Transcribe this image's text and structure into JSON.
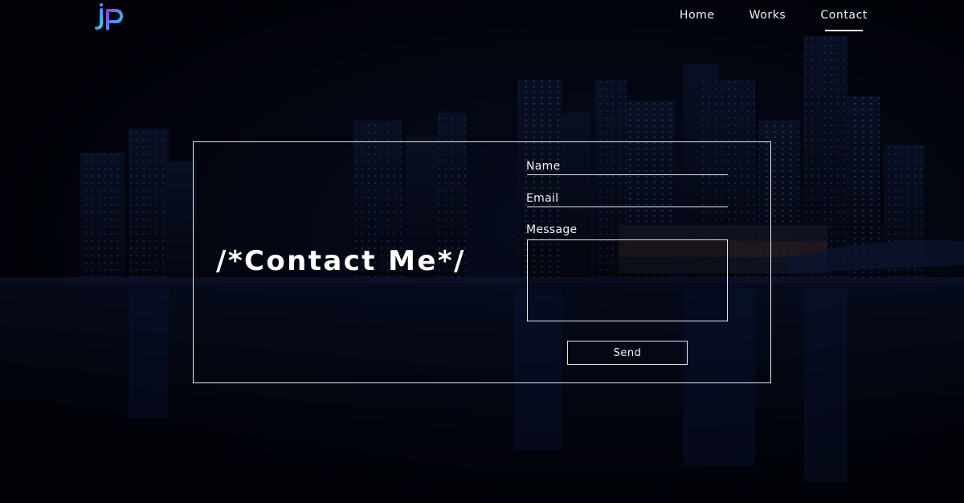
{
  "logo": {
    "icon": "jp-monogram-logo",
    "gradient": [
      "#7b3fe4",
      "#2fd6f2"
    ]
  },
  "nav": {
    "items": [
      {
        "label": "Home"
      },
      {
        "label": "Works"
      },
      {
        "label": "Contact",
        "active": true
      }
    ]
  },
  "contact": {
    "heading": "/*Contact Me*/",
    "name_label": "Name",
    "email_label": "Email",
    "message_label": "Message",
    "send_label": "Send"
  },
  "theme": {
    "background": "#02030a",
    "text": "#ffffff",
    "border": "#e6e6e6"
  }
}
